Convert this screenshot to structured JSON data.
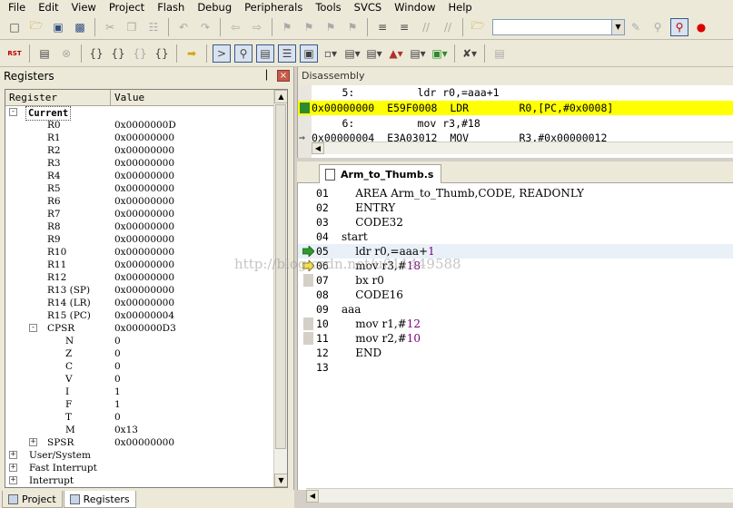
{
  "menu": [
    "File",
    "Edit",
    "View",
    "Project",
    "Flash",
    "Debug",
    "Peripherals",
    "Tools",
    "SVCS",
    "Window",
    "Help"
  ],
  "toolbar2": {
    "rst_label": "RST"
  },
  "registers_panel": {
    "title": "Registers",
    "col_register": "Register",
    "col_value": "Value",
    "current_label": "Current",
    "regs": [
      {
        "name": "R0",
        "value": "0x0000000D"
      },
      {
        "name": "R1",
        "value": "0x00000000"
      },
      {
        "name": "R2",
        "value": "0x00000000"
      },
      {
        "name": "R3",
        "value": "0x00000000"
      },
      {
        "name": "R4",
        "value": "0x00000000"
      },
      {
        "name": "R5",
        "value": "0x00000000"
      },
      {
        "name": "R6",
        "value": "0x00000000"
      },
      {
        "name": "R7",
        "value": "0x00000000"
      },
      {
        "name": "R8",
        "value": "0x00000000"
      },
      {
        "name": "R9",
        "value": "0x00000000"
      },
      {
        "name": "R10",
        "value": "0x00000000"
      },
      {
        "name": "R11",
        "value": "0x00000000"
      },
      {
        "name": "R12",
        "value": "0x00000000"
      },
      {
        "name": "R13 (SP)",
        "value": "0x00000000"
      },
      {
        "name": "R14 (LR)",
        "value": "0x00000000"
      },
      {
        "name": "R15 (PC)",
        "value": "0x00000004"
      }
    ],
    "cpsr": {
      "name": "CPSR",
      "value": "0x000000D3"
    },
    "flags": [
      {
        "name": "N",
        "value": "0"
      },
      {
        "name": "Z",
        "value": "0"
      },
      {
        "name": "C",
        "value": "0"
      },
      {
        "name": "V",
        "value": "0"
      },
      {
        "name": "I",
        "value": "1"
      },
      {
        "name": "F",
        "value": "1"
      },
      {
        "name": "T",
        "value": "0"
      },
      {
        "name": "M",
        "value": "0x13"
      }
    ],
    "spsr": {
      "name": "SPSR",
      "value": "0x00000000"
    },
    "modes": [
      "User/System",
      "Fast Interrupt",
      "Interrupt"
    ]
  },
  "bottom_tabs": [
    "Project",
    "Registers"
  ],
  "disassembly": {
    "title": "Disassembly",
    "lines": [
      "       5:          ldr r0,=aaa+1",
      "0x00000000  E59F0008  LDR        R0,[PC,#0x0008]",
      "       6:          mov r3,#18",
      "0x00000004  E3A03012  MOV        R3,#0x00000012"
    ]
  },
  "editor": {
    "tab_label": "Arm_to_Thumb.s",
    "watermark": "http://blog.csdn.net/u011449588",
    "lines": [
      {
        "ln": "01",
        "code": "    AREA Arm_to_Thumb,CODE, READONLY"
      },
      {
        "ln": "02",
        "code": "    ENTRY"
      },
      {
        "ln": "03",
        "code": "    CODE32"
      },
      {
        "ln": "04",
        "code": "start"
      },
      {
        "ln": "05",
        "code": "    ldr r0,=aaa+",
        "num": "1"
      },
      {
        "ln": "06",
        "code": "    mov r3,#",
        "num": "18"
      },
      {
        "ln": "07",
        "code": "    bx r0"
      },
      {
        "ln": "08",
        "code": "    CODE16"
      },
      {
        "ln": "09",
        "code": "aaa"
      },
      {
        "ln": "10",
        "code": "    mov r1,#",
        "num": "12"
      },
      {
        "ln": "11",
        "code": "    mov r2,#",
        "num": "10"
      },
      {
        "ln": "12",
        "code": "    END"
      },
      {
        "ln": "13",
        "code": ""
      }
    ]
  }
}
